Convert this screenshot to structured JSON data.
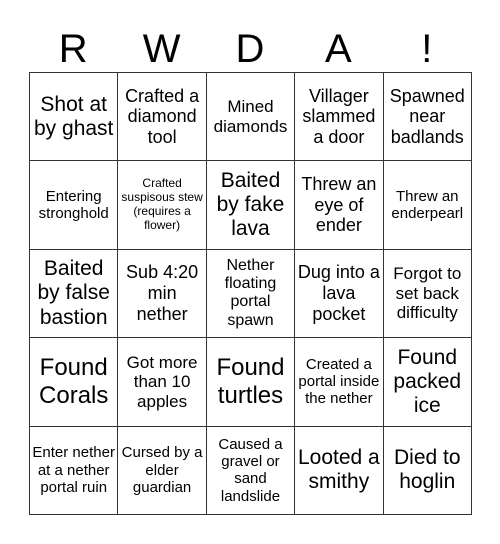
{
  "title_letters": [
    "R",
    "W",
    "D",
    "A",
    "!"
  ],
  "board": {
    "rows": [
      [
        {
          "text": "Shot at by ghast",
          "size": "s-l"
        },
        {
          "text": "Crafted a diamond tool",
          "size": "s-m"
        },
        {
          "text": "Mined diamonds",
          "size": "s-ms"
        },
        {
          "text": "Villager slammed a door",
          "size": "s-m"
        },
        {
          "text": "Spawned near badlands",
          "size": "s-m"
        }
      ],
      [
        {
          "text": "Entering stronghold",
          "size": "s-xs"
        },
        {
          "text": "Crafted suspisous stew (requires a flower)",
          "size": "s-xxs"
        },
        {
          "text": "Baited by fake lava",
          "size": "s-l"
        },
        {
          "text": "Threw an eye of ender",
          "size": "s-m"
        },
        {
          "text": "Threw an enderpearl",
          "size": "s-xs"
        }
      ],
      [
        {
          "text": "Baited by false bastion",
          "size": "s-l"
        },
        {
          "text": "Sub 4:20 min nether",
          "size": "s-m"
        },
        {
          "text": "Nether floating portal spawn",
          "size": "s-s"
        },
        {
          "text": "Dug into a lava pocket",
          "size": "s-m"
        },
        {
          "text": "Forgot to set back difficulty",
          "size": "s-ms"
        }
      ],
      [
        {
          "text": "Found Corals",
          "size": "s-xl"
        },
        {
          "text": "Got more than 10 apples",
          "size": "s-ms"
        },
        {
          "text": "Found turtles",
          "size": "s-xl"
        },
        {
          "text": "Created a portal inside the nether",
          "size": "s-xs"
        },
        {
          "text": "Found packed ice",
          "size": "s-l"
        }
      ],
      [
        {
          "text": "Enter nether at a nether portal ruin",
          "size": "s-xs"
        },
        {
          "text": "Cursed by a elder guardian",
          "size": "s-xs"
        },
        {
          "text": "Caused a gravel or sand landslide",
          "size": "s-xs"
        },
        {
          "text": "Looted a smithy",
          "size": "s-l"
        },
        {
          "text": "Died to hoglin",
          "size": "s-l"
        }
      ]
    ]
  }
}
